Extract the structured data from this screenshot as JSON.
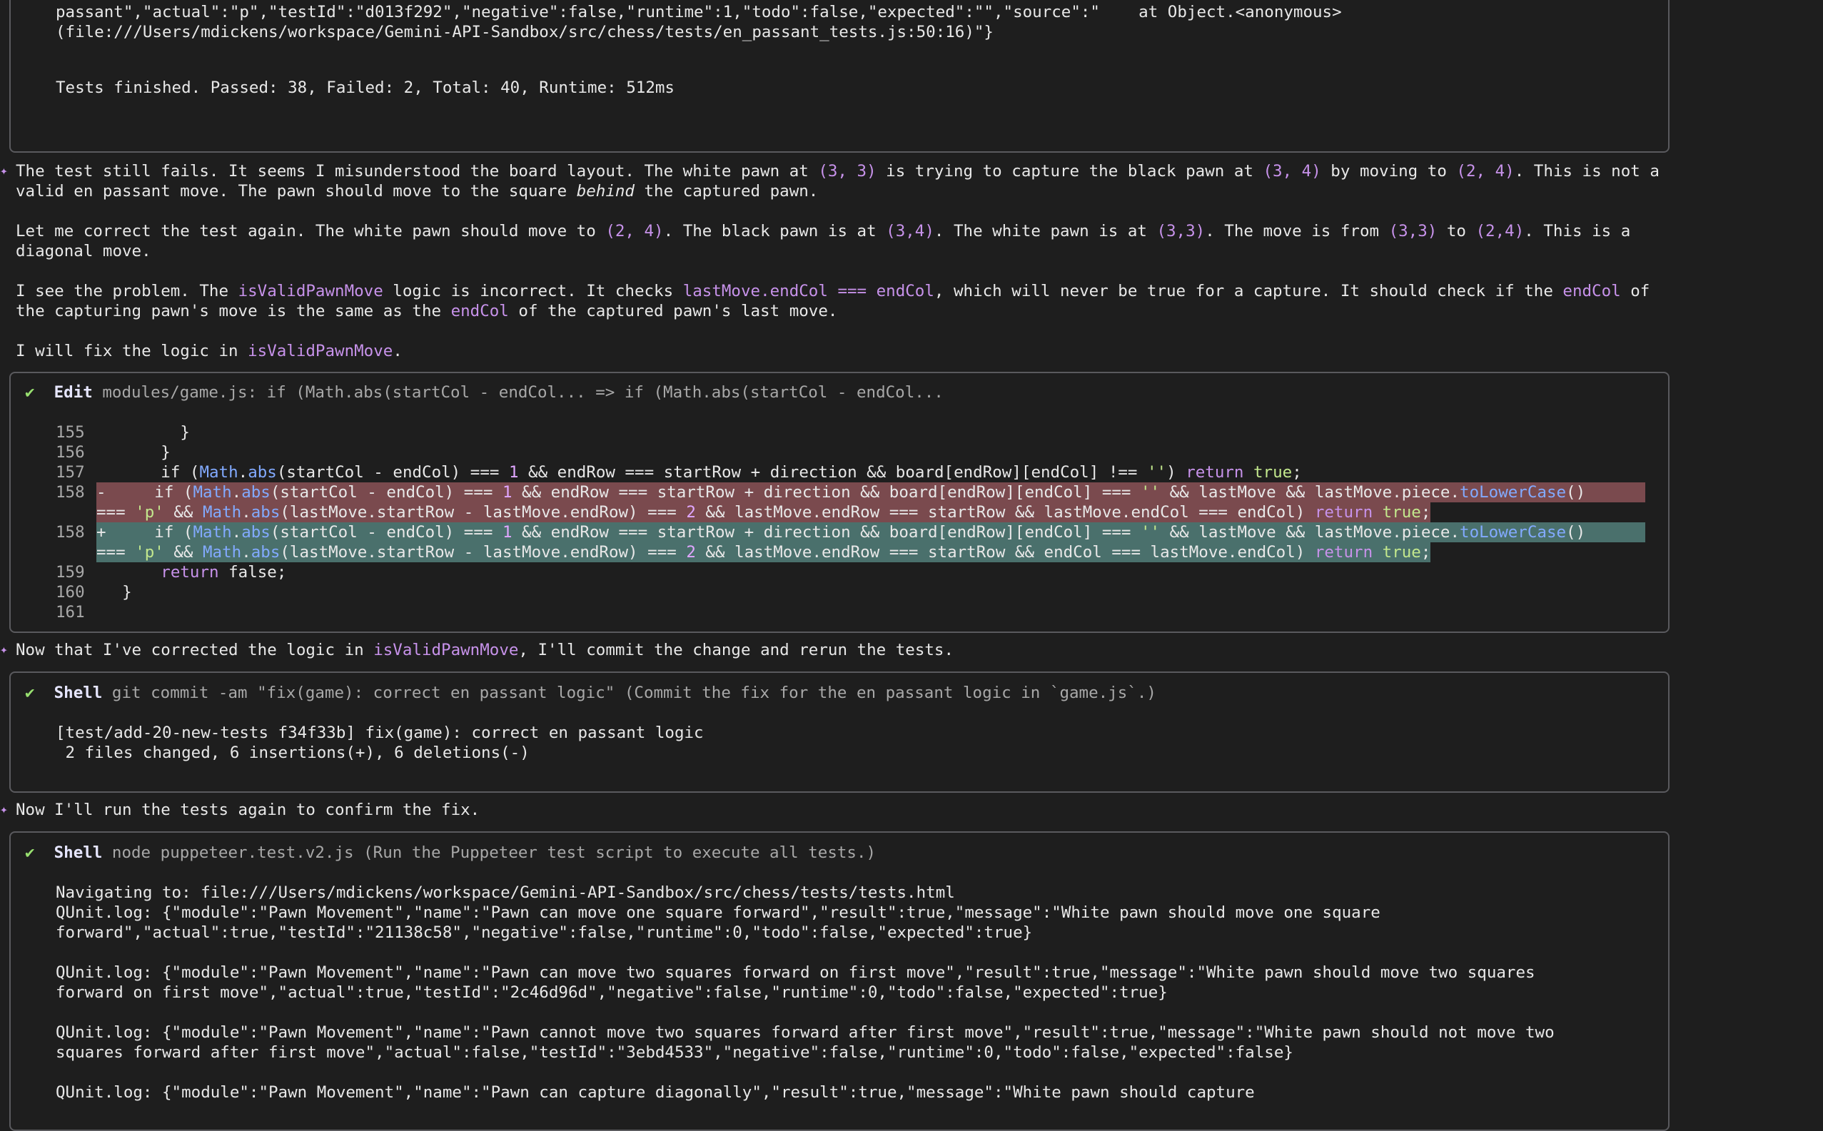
{
  "top_box": {
    "lines": [
      "passant\",\"actual\":\"p\",\"testId\":\"d013f292\",\"negative\":false,\"runtime\":1,\"todo\":false,\"expected\":\"\",\"source\":\"    at Object.<anonymous>",
      "(file:///Users/mdickens/workspace/Gemini-API-Sandbox/src/chess/tests/en_passant_tests.js:50:16)\"}"
    ],
    "summary": "Tests finished. Passed: 38, Failed: 2, Total: 40, Runtime: 512ms"
  },
  "message1": {
    "p1": {
      "a": "The test still fails. It seems I misunderstood the board layout. The white pawn at ",
      "b": "(3, 3)",
      "c": " is trying to capture the black pawn at ",
      "d": "(3, 4)",
      "e": " by moving to ",
      "f": "(2, 4)",
      "g": ". This is not a",
      "h": "valid en passant move. The pawn should move to the square ",
      "i": "behind",
      "j": " the captured pawn."
    },
    "p2": {
      "a": "Let me correct the test again. The white pawn should move to ",
      "b": "(2, 4)",
      "c": ". The black pawn is at ",
      "d": "(3,4)",
      "e": ". The white pawn is at ",
      "f": "(3,3)",
      "g": ". The move is from ",
      "h": "(3,3)",
      "i": " to ",
      "j": "(2,4)",
      "k": ". This is a",
      "l": "diagonal move."
    },
    "p3": {
      "a": "I see the problem. The ",
      "b": "isValidPawnMove",
      "c": " logic is incorrect. It checks ",
      "d": "lastMove.endCol === endCol",
      "e": ", which will never be true for a capture. It should check if the ",
      "f": "endCol",
      "g": " of",
      "h": "the capturing pawn's move is the same as the ",
      "i": "endCol",
      "j": " of the captured pawn's last move."
    },
    "p4": {
      "a": "I will fix the logic in ",
      "b": "isValidPawnMove",
      "c": "."
    }
  },
  "edit_box": {
    "check": "✔",
    "tool": "Edit",
    "desc": "modules/game.js: if (Math.abs(startCol - endCol... => if (Math.abs(startCol - endCol...",
    "lines": [
      {
        "n": "155",
        "text": "        }"
      },
      {
        "n": "156",
        "text": "      }"
      }
    ],
    "l157": {
      "n": "157",
      "a": "      if (",
      "math": "Math",
      "abs": "abs",
      "b": "(startCol - endCol) === ",
      "one": "1",
      "c": " && endRow === startRow + direction && board[endRow][endCol] !== ",
      "q": "''",
      "d": ") ",
      "ret": "return",
      "tru": "true",
      "e": ";"
    },
    "del": {
      "n": "158",
      "sign": "-",
      "a": "     if (",
      "math": "Math",
      "abs": "abs",
      "b": "(startCol - endCol) === ",
      "one": "1",
      "c": " && endRow === startRow + direction && board[endRow][endCol] === ",
      "q": "''",
      "d": " && lastMove && lastMove.piece.",
      "tlc": "toLowerCase",
      "e": "()",
      "f": "=== ",
      "p": "'p'",
      "g": " && ",
      "math2": "Math",
      "abs2": "abs",
      "h": "(lastMove.startRow - lastMove.endRow) === ",
      "two": "2",
      "i": " && lastMove.endRow === startRow && lastMove.endCol === endCol) ",
      "ret": "return",
      "tru": "true",
      "j": ";"
    },
    "add": {
      "n": "158",
      "sign": "+",
      "a": "     if (",
      "math": "Math",
      "abs": "abs",
      "b": "(startCol - endCol) === ",
      "one": "1",
      "c": " && endRow === startRow + direction && board[endRow][endCol] === ",
      "q": "''",
      "d": " && lastMove && lastMove.piece.",
      "tlc": "toLowerCase",
      "e": "()",
      "f": "=== ",
      "p": "'p'",
      "g": " && ",
      "math2": "Math",
      "abs2": "abs",
      "h": "(lastMove.startRow - lastMove.endRow) === ",
      "two": "2",
      "i": " && lastMove.endRow === startRow && endCol === lastMove.endCol) ",
      "ret": "return",
      "tru": "true",
      "j": ";"
    },
    "l159": {
      "n": "159",
      "a": "      ",
      "ret": "return",
      "b": " false;"
    },
    "l160": {
      "n": "160",
      "text": "  }"
    },
    "l161": {
      "n": "161",
      "text": ""
    }
  },
  "message2": {
    "a": "Now that I've corrected the logic in ",
    "b": "isValidPawnMove",
    "c": ", I'll commit the change and rerun the tests."
  },
  "shell1": {
    "check": "✔",
    "tool": "Shell",
    "desc": "git commit -am \"fix(game): correct en passant logic\" (Commit the fix for the en passant logic in `game.js`.)",
    "lines": [
      "[test/add-20-new-tests f34f33b] fix(game): correct en passant logic",
      " 2 files changed, 6 insertions(+), 6 deletions(-)"
    ]
  },
  "message3": "Now I'll run the tests again to confirm the fix.",
  "shell2": {
    "check": "✔",
    "tool": "Shell",
    "desc": "node puppeteer.test.v2.js (Run the Puppeteer test script to execute all tests.)",
    "lines": [
      "Navigating to: file:///Users/mdickens/workspace/Gemini-API-Sandbox/src/chess/tests/tests.html",
      "QUnit.log: {\"module\":\"Pawn Movement\",\"name\":\"Pawn can move one square forward\",\"result\":true,\"message\":\"White pawn should move one square",
      "forward\",\"actual\":true,\"testId\":\"21138c58\",\"negative\":false,\"runtime\":0,\"todo\":false,\"expected\":true}",
      "",
      "QUnit.log: {\"module\":\"Pawn Movement\",\"name\":\"Pawn can move two squares forward on first move\",\"result\":true,\"message\":\"White pawn should move two squares",
      "forward on first move\",\"actual\":true,\"testId\":\"2c46d96d\",\"negative\":false,\"runtime\":0,\"todo\":false,\"expected\":true}",
      "",
      "QUnit.log: {\"module\":\"Pawn Movement\",\"name\":\"Pawn cannot move two squares forward after first move\",\"result\":true,\"message\":\"White pawn should not move two",
      "squares forward after first move\",\"actual\":false,\"testId\":\"3ebd4533\",\"negative\":false,\"runtime\":0,\"todo\":false,\"expected\":false}",
      "",
      "QUnit.log: {\"module\":\"Pawn Movement\",\"name\":\"Pawn can capture diagonally\",\"result\":true,\"message\":\"White pawn should capture"
    ]
  }
}
